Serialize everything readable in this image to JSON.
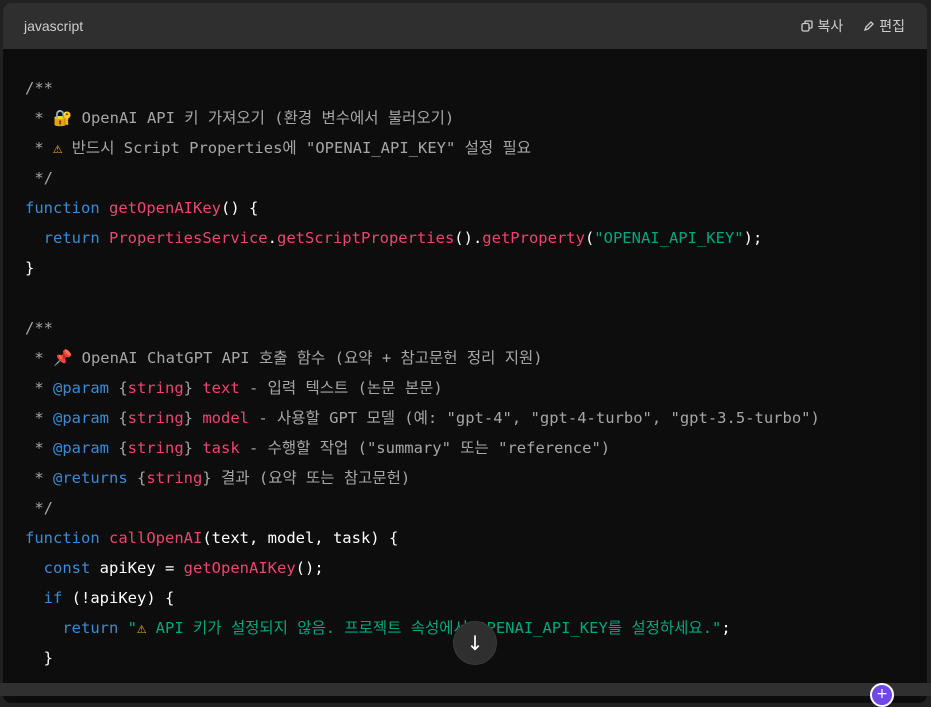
{
  "header": {
    "language": "javascript",
    "copy_label": "복사",
    "edit_label": "편집"
  },
  "icons": {
    "copy": "copy-icon",
    "edit": "pencil-icon",
    "scroll": "arrow-down-icon"
  },
  "code_lines": [
    [
      [
        "c",
        "/**"
      ]
    ],
    [
      [
        "c",
        " * "
      ],
      [
        "e",
        "🔐"
      ],
      [
        "c",
        " OpenAI API 키 가져오기 (환경 변수에서 불러오기)"
      ]
    ],
    [
      [
        "c",
        " * "
      ],
      [
        "e",
        "⚠"
      ],
      [
        "c",
        " 반드시 Script Properties에 \"OPENAI_API_KEY\" 설정 필요"
      ]
    ],
    [
      [
        "c",
        " */"
      ]
    ],
    [
      [
        "k",
        "function "
      ],
      [
        "f",
        "getOpenAIKey"
      ],
      [
        "p",
        "() {"
      ]
    ],
    [
      [
        "p",
        "  "
      ],
      [
        "k",
        "return "
      ],
      [
        "f",
        "PropertiesService"
      ],
      [
        "p",
        "."
      ],
      [
        "f",
        "getScriptProperties"
      ],
      [
        "p",
        "()."
      ],
      [
        "f",
        "getProperty"
      ],
      [
        "p",
        "("
      ],
      [
        "s",
        "\"OPENAI_API_KEY\""
      ],
      [
        "p",
        ");"
      ]
    ],
    [
      [
        "p",
        "}"
      ]
    ],
    [
      [
        "p",
        ""
      ]
    ],
    [
      [
        "c",
        "/**"
      ]
    ],
    [
      [
        "c",
        " * "
      ],
      [
        "e",
        "📌"
      ],
      [
        "c",
        " OpenAI ChatGPT API 호출 함수 (요약 + 참고문헌 정리 지원)"
      ]
    ],
    [
      [
        "c",
        " * "
      ],
      [
        "k",
        "@param "
      ],
      [
        "c",
        "{"
      ],
      [
        "f",
        "string"
      ],
      [
        "c",
        "} "
      ],
      [
        "f",
        "text"
      ],
      [
        "c",
        " - 입력 텍스트 (논문 본문)"
      ]
    ],
    [
      [
        "c",
        " * "
      ],
      [
        "k",
        "@param "
      ],
      [
        "c",
        "{"
      ],
      [
        "f",
        "string"
      ],
      [
        "c",
        "} "
      ],
      [
        "f",
        "model"
      ],
      [
        "c",
        " - 사용할 GPT 모델 (예: \"gpt-4\", \"gpt-4-turbo\", \"gpt-3.5-turbo\")"
      ]
    ],
    [
      [
        "c",
        " * "
      ],
      [
        "k",
        "@param "
      ],
      [
        "c",
        "{"
      ],
      [
        "f",
        "string"
      ],
      [
        "c",
        "} "
      ],
      [
        "f",
        "task"
      ],
      [
        "c",
        " - 수행할 작업 (\"summary\" 또는 \"reference\")"
      ]
    ],
    [
      [
        "c",
        " * "
      ],
      [
        "k",
        "@returns "
      ],
      [
        "c",
        "{"
      ],
      [
        "f",
        "string"
      ],
      [
        "c",
        "} 결과 (요약 또는 참고문헌)"
      ]
    ],
    [
      [
        "c",
        " */"
      ]
    ],
    [
      [
        "k",
        "function "
      ],
      [
        "f",
        "callOpenAI"
      ],
      [
        "p",
        "(text, model, task) {"
      ]
    ],
    [
      [
        "p",
        "  "
      ],
      [
        "k",
        "const "
      ],
      [
        "p",
        "apiKey = "
      ],
      [
        "f",
        "getOpenAIKey"
      ],
      [
        "p",
        "();"
      ]
    ],
    [
      [
        "p",
        "  "
      ],
      [
        "k",
        "if "
      ],
      [
        "p",
        "(!apiKey) {"
      ]
    ],
    [
      [
        "p",
        "    "
      ],
      [
        "k",
        "return "
      ],
      [
        "s",
        "\""
      ],
      [
        "e",
        "⚠"
      ],
      [
        "s",
        " API 키가 설정되지 않음. 프로젝트 속성에서 OPENAI_API_KEY를 설정하세요.\""
      ],
      [
        "p",
        ";"
      ]
    ],
    [
      [
        "p",
        "  }"
      ]
    ]
  ]
}
